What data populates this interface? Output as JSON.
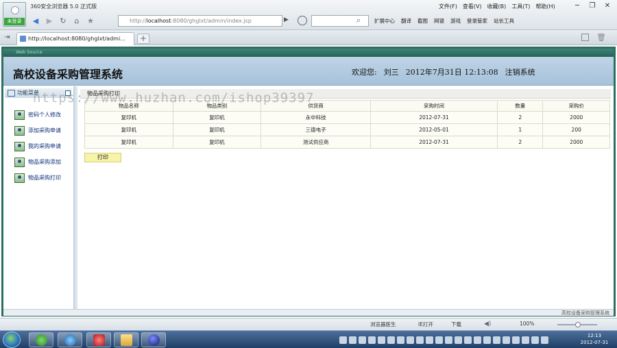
{
  "browser": {
    "app_name": "360安全浏览器 5.0 正式版",
    "avatar_label": "未登录",
    "menu": [
      "文件(F)",
      "查看(V)",
      "收藏(B)",
      "工具(T)",
      "帮助(H)"
    ],
    "window_controls": [
      "─",
      "❐",
      "✕"
    ],
    "address_prefix": "http://",
    "address_host": "localhost",
    "address_rest": ":8080/ghglxt/admin/index.jsp",
    "search_placeholder": "",
    "toolbar": [
      "扩展中心",
      "翻译",
      "截图",
      "网银",
      "游戏",
      "登录管家",
      "站长工具"
    ],
    "tab_title": "http://localhost:8080/ghglxt/admi...",
    "newtab_label": "+",
    "frame_caption": "Web Source",
    "status_items": [
      "浏览器医生",
      "IE打开",
      "下载",
      "100%"
    ],
    "accent": "#2e6e62"
  },
  "page": {
    "system_title": "高校设备采购管理系统",
    "welcome_label": "欢迎您:",
    "user_name": "刘三",
    "datetime": "2012年7月31日  12:13:08",
    "logout_label": "注销系统",
    "menu_title": "功能菜单",
    "menu_items": [
      "密码个人修改",
      "添加采购申请",
      "我的采购申请",
      "物品采购添加",
      "物品采购打印"
    ],
    "breadcrumb": "物品采购打印",
    "table": {
      "headers": [
        "物品名称",
        "物品类别",
        "供货商",
        "采购时间",
        "数量",
        "采购价"
      ],
      "rows": [
        [
          "复印机",
          "复印机",
          "永中科技",
          "2012-07-31",
          "2",
          "2000"
        ],
        [
          "复印机",
          "复印机",
          "三德电子",
          "2012-05-01",
          "1",
          "200"
        ],
        [
          "复印机",
          "复印机",
          "测试供应商",
          "2012-07-31",
          "2",
          "2000"
        ]
      ]
    },
    "print_button": "打印",
    "footer": "高校设备采购管理系统",
    "watermark": "https://www.huzhan.com/ishop39397"
  },
  "taskbar": {
    "clock_time": "12:13",
    "clock_date": "2012-07-31"
  }
}
